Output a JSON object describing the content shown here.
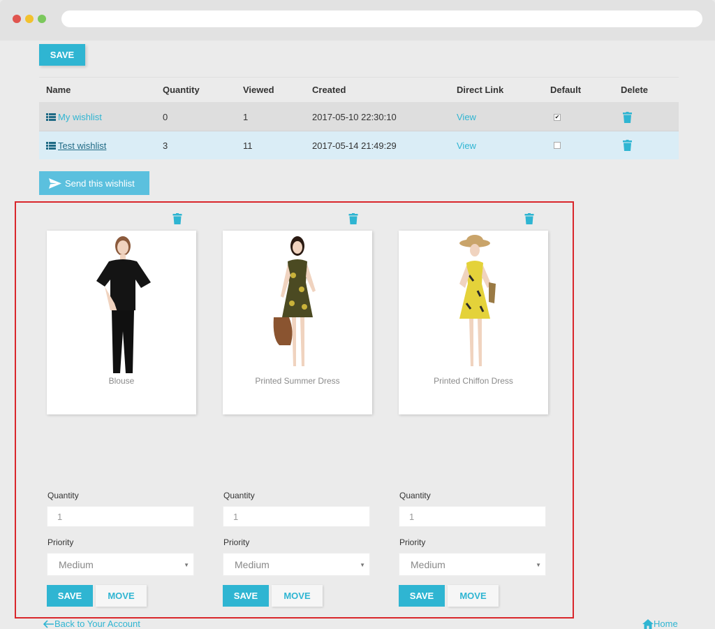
{
  "toolbar": {
    "save_label": "SAVE"
  },
  "table": {
    "headers": {
      "name": "Name",
      "quantity": "Quantity",
      "viewed": "Viewed",
      "created": "Created",
      "direct_link": "Direct Link",
      "default": "Default",
      "delete": "Delete"
    },
    "rows": [
      {
        "name": "My wishlist",
        "quantity": "0",
        "viewed": "1",
        "created": "2017-05-10 22:30:10",
        "link": "View",
        "default": true
      },
      {
        "name": "Test wishlist",
        "quantity": "3",
        "viewed": "11",
        "created": "2017-05-14 21:49:29",
        "link": "View",
        "default": false
      }
    ]
  },
  "send_label": "Send this wishlist",
  "products": [
    {
      "name": "Blouse",
      "quantity_label": "Quantity",
      "quantity": "1",
      "priority_label": "Priority",
      "priority": "Medium",
      "save_label": "SAVE",
      "move_label": "MOVE"
    },
    {
      "name": "Printed Summer Dress",
      "quantity_label": "Quantity",
      "quantity": "1",
      "priority_label": "Priority",
      "priority": "Medium",
      "save_label": "SAVE",
      "move_label": "MOVE"
    },
    {
      "name": "Printed Chiffon Dress",
      "quantity_label": "Quantity",
      "quantity": "1",
      "priority_label": "Priority",
      "priority": "Medium",
      "save_label": "SAVE",
      "move_label": "MOVE"
    }
  ],
  "footer": {
    "back_label": "Back to Your Account",
    "home_label": "Home"
  },
  "colors": {
    "accent": "#2fb5d2",
    "highlight": "#d9262b"
  },
  "icons": {
    "list": "list-icon",
    "trash": "trash-icon",
    "send": "paper-plane-icon",
    "home": "home-icon",
    "back": "arrow-left-icon"
  }
}
